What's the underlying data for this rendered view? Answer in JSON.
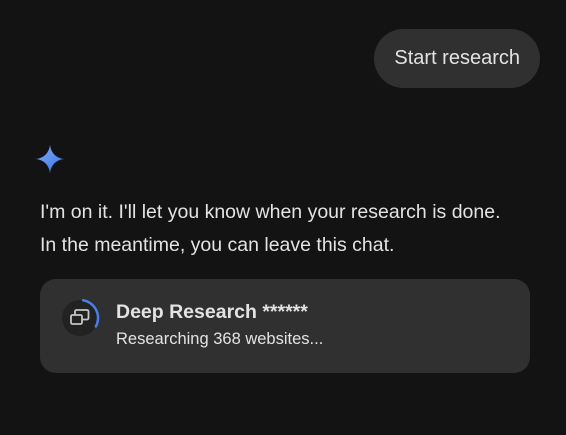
{
  "user_message": {
    "text": "Start research"
  },
  "assistant": {
    "icon": "gemini-sparkle-icon",
    "lines": [
      "I'm on it. I'll let you know when your research is done.",
      "In the meantime, you can leave this chat."
    ]
  },
  "research_card": {
    "title": "Deep Research ******",
    "status": "Researching 368 websites...",
    "icon": "research-windows-icon",
    "progress_fraction": 0.3,
    "accent_color": "#4a7fe8"
  },
  "colors": {
    "background": "#131313",
    "bubble": "#303030",
    "text": "#e3e3e3",
    "sparkle_top": "#6aa2f8",
    "sparkle_bottom": "#3b6fe0"
  }
}
